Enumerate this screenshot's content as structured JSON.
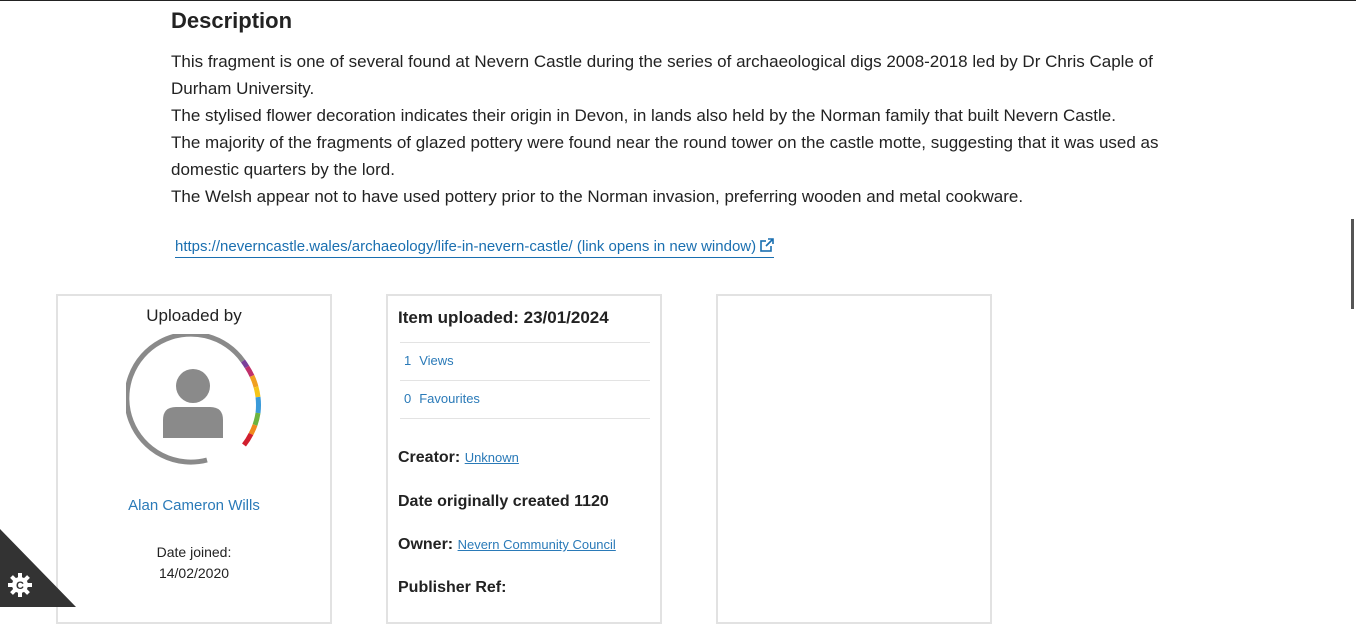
{
  "description": {
    "heading": "Description",
    "paragraphs": [
      "This fragment is one of several found at Nevern Castle during the series of archaeological digs 2008-2018 led by Dr Chris Caple of Durham University.",
      "The stylised flower decoration indicates their origin in Devon, in lands also held by the Norman family that built Nevern Castle.",
      "The majority of the fragments of glazed pottery were found near the round tower on the castle motte, suggesting that it was used as domestic quarters by the lord.",
      "The Welsh appear not to have used pottery prior to the Norman invasion, preferring wooden and metal cookware."
    ],
    "link_text": "https://neverncastle.wales/archaeology/life-in-nevern-castle/ (link opens in new window)"
  },
  "uploader": {
    "label": "Uploaded by",
    "name": "Alan Cameron Wills",
    "date_joined_label": "Date joined:",
    "date_joined": "14/02/2020",
    "avatar_icon": "user-avatar-icon"
  },
  "item": {
    "uploaded": "Item uploaded: 23/01/2024",
    "views_count": "1",
    "views_label": "Views",
    "favs_count": "0",
    "favs_label": "Favourites",
    "creator_label": "Creator:",
    "creator_value": "Unknown",
    "date_created": "Date originally created 1120",
    "owner_label": "Owner:",
    "owner_value": "Nevern Community Council",
    "publisher_ref_label": "Publisher Ref:"
  },
  "colors": {
    "link": "#2a7ab8",
    "text": "#222222",
    "card_border": "#e2e2e2",
    "avatar_grey": "#8a8a8a"
  },
  "cookie_icon": "gear-icon"
}
